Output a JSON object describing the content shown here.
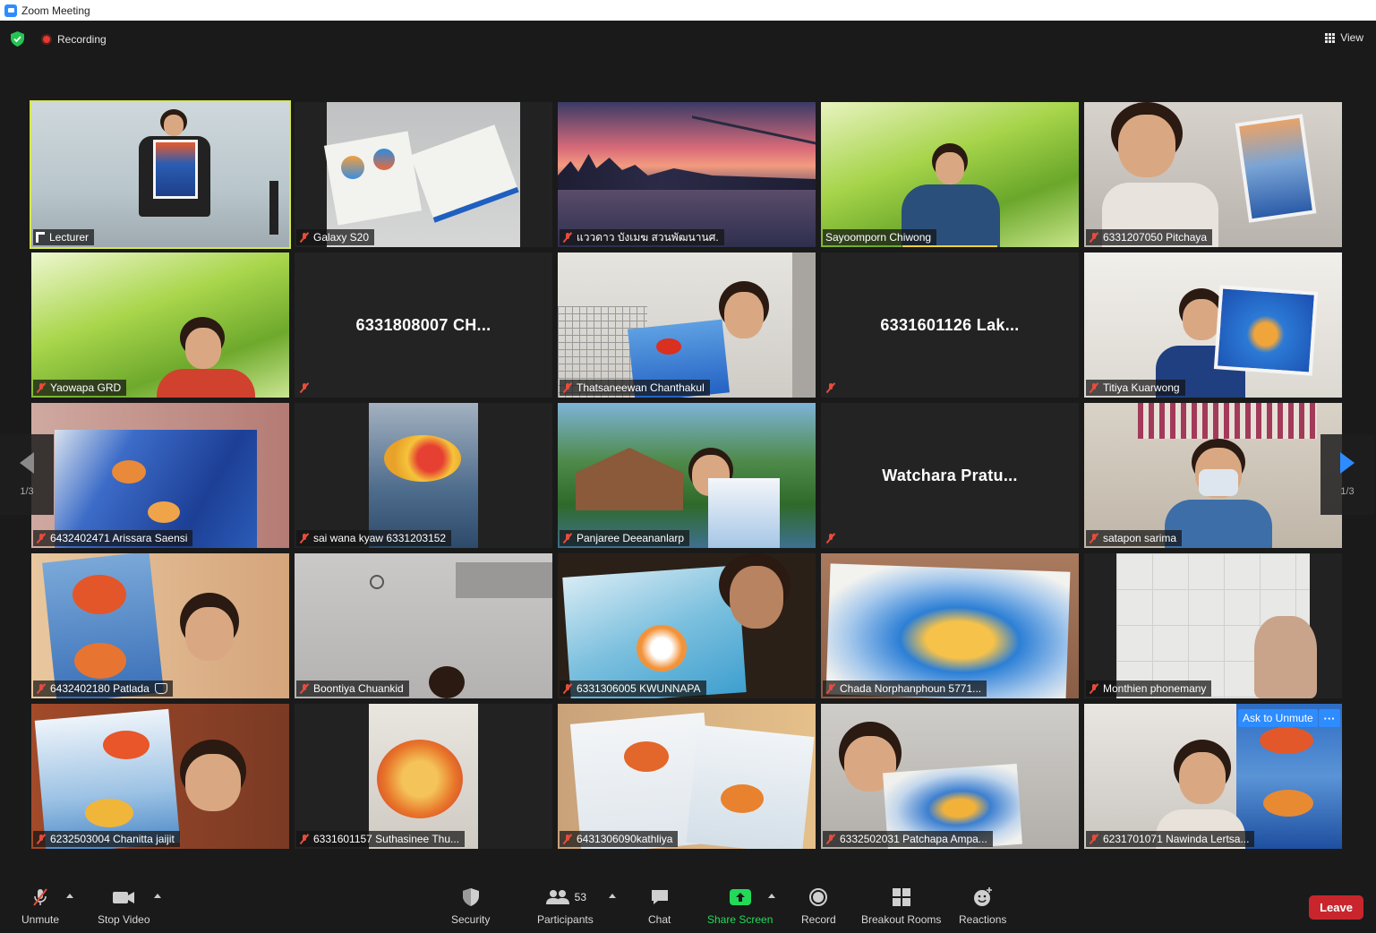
{
  "window": {
    "title": "Zoom Meeting"
  },
  "topbar": {
    "recording_label": "Recording",
    "view_label": "View"
  },
  "pagination": {
    "left_page": "1/3",
    "right_page": "1/3"
  },
  "tiles": [
    {
      "name": "Lecturer",
      "mic": "pinned",
      "scene": "lecturer"
    },
    {
      "name": "Galaxy S20",
      "mic": "muted",
      "scene": "desk"
    },
    {
      "name": "แววดาว บังเมฆ สวนพัฒนานศ.",
      "mic": "muted",
      "scene": "city"
    },
    {
      "name": "Sayoomporn Chiwong",
      "mic": "on",
      "scene": "grass-boy"
    },
    {
      "name": "6331207050 Pitchaya",
      "mic": "muted",
      "scene": "girl-fish"
    },
    {
      "name": "Yaowapa GRD",
      "mic": "muted",
      "scene": "grass-woman"
    },
    {
      "name": "",
      "center_name": "6331808007 CH...",
      "mic": "muted",
      "scene": "blank"
    },
    {
      "name": "Thatsaneewan Chanthakul",
      "mic": "muted",
      "scene": "office-girl"
    },
    {
      "name": "",
      "center_name": "6331601126 Lak...",
      "mic": "muted",
      "scene": "blank"
    },
    {
      "name": "Titiya Kuarwong",
      "mic": "muted",
      "scene": "woman-blue"
    },
    {
      "name": "6432402471 Arissara Saensi",
      "mic": "muted",
      "scene": "painting-blue"
    },
    {
      "name": "sai wana kyaw 6331203152",
      "mic": "muted",
      "scene": "painting-narrow"
    },
    {
      "name": "Panjaree Deeananlarp",
      "mic": "muted",
      "scene": "garden"
    },
    {
      "name": "",
      "center_name": "Watchara Pratu...",
      "mic": "muted",
      "scene": "blank"
    },
    {
      "name": "satapon sarima",
      "mic": "muted",
      "scene": "mask-man"
    },
    {
      "name": "6432402180 Patlada",
      "mic": "muted",
      "scene": "sketchbook",
      "hand_raised": true
    },
    {
      "name": "Boontiya Chuankid",
      "mic": "muted",
      "scene": "room"
    },
    {
      "name": "6331306005 KWUNNAPA",
      "mic": "muted",
      "scene": "headset-girl"
    },
    {
      "name": "Chada Norphanphoun 5771...",
      "mic": "muted",
      "scene": "big-fish"
    },
    {
      "name": "Monthien phonemany",
      "mic": "muted",
      "scene": "ceiling"
    },
    {
      "name": "6232503004 Chanitta jaijit",
      "mic": "muted",
      "scene": "girl-glasses"
    },
    {
      "name": "6331601157 Suthasinee Thu...",
      "mic": "muted",
      "scene": "orange-fish"
    },
    {
      "name": "6431306090kathliya",
      "mic": "muted",
      "scene": "two-papers"
    },
    {
      "name": "6332502031 Patchapa Ampa...",
      "mic": "muted",
      "scene": "girl-paper"
    },
    {
      "name": "6231701071 Nawinda Lertsa...",
      "mic": "muted",
      "scene": "girl-painting",
      "ask_to_unmute": "Ask to Unmute",
      "more_label": "···"
    }
  ],
  "toolbar": {
    "unmute": "Unmute",
    "stop_video": "Stop Video",
    "security": "Security",
    "participants": "Participants",
    "participants_count": "53",
    "chat": "Chat",
    "share_screen": "Share Screen",
    "record": "Record",
    "breakout_rooms": "Breakout Rooms",
    "reactions": "Reactions",
    "leave": "Leave"
  },
  "colors": {
    "accent_blue": "#2d8cff",
    "leave_red": "#c8262c",
    "share_green": "#23d959",
    "active_speaker": "#d6e84a",
    "mute_red": "#e74c3c"
  }
}
